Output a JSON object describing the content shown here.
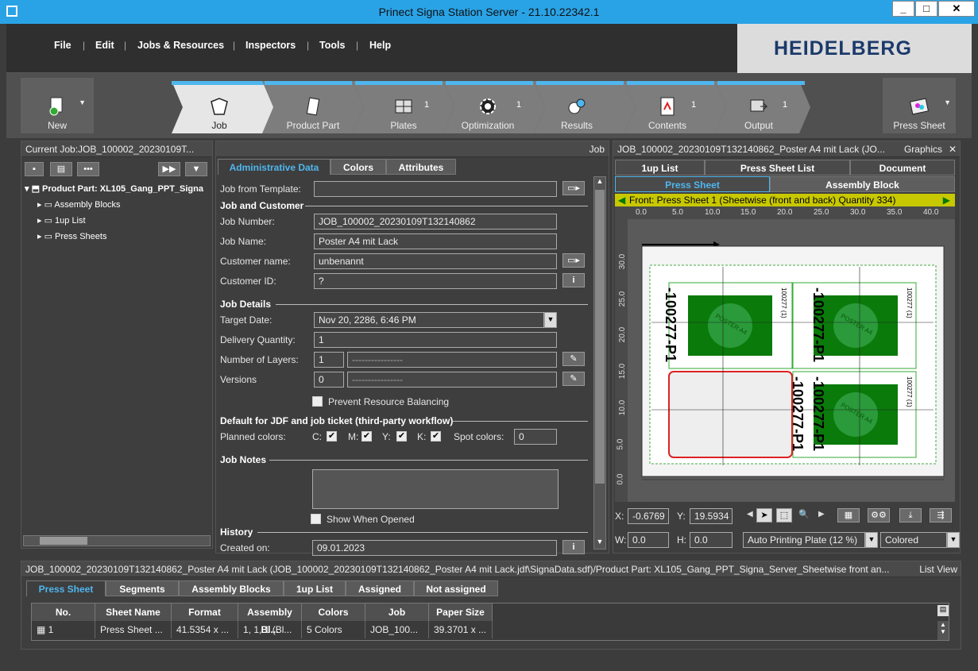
{
  "window": {
    "title": "Prinect Signa Station Server  -  21.10.22342.1",
    "min": "_",
    "max": "□",
    "close": "✕"
  },
  "menu": [
    "File",
    "Edit",
    "Jobs & Resources",
    "Inspectors",
    "Tools",
    "Help"
  ],
  "brand": "HEIDELBERG",
  "toolbar": {
    "new": "New",
    "press_sheet": "Press Sheet",
    "steps": [
      {
        "label": "Job",
        "count": ""
      },
      {
        "label": "Product Part",
        "count": ""
      },
      {
        "label": "Plates",
        "count": "1"
      },
      {
        "label": "Optimization",
        "count": "1"
      },
      {
        "label": "Results",
        "count": ""
      },
      {
        "label": "Contents",
        "count": "1"
      },
      {
        "label": "Output",
        "count": "1"
      }
    ]
  },
  "left": {
    "header": "Current Job:JOB_100002_20230109T...",
    "tree": {
      "root": "Product Part: XL105_Gang_PPT_Signa",
      "children": [
        "Assembly Blocks",
        "1up List",
        "Press Sheets"
      ]
    }
  },
  "center": {
    "header": "Job",
    "tabs": [
      "Administrative Data",
      "Colors",
      "Attributes"
    ],
    "job_from_template": "Job from Template:",
    "sec_job_customer": "Job and Customer",
    "job_number_l": "Job Number:",
    "job_number": "JOB_100002_20230109T132140862",
    "job_name_l": "Job Name:",
    "job_name": "Poster A4 mit Lack",
    "customer_name_l": "Customer name:",
    "customer_name": "unbenannt",
    "customer_id_l": "Customer ID:",
    "customer_id": "?",
    "sec_job_details": "Job Details",
    "target_date_l": "Target Date:",
    "target_date": "Nov 20, 2286, 6:46 PM",
    "delivery_qty_l": "Delivery Quantity:",
    "delivery_qty": "1",
    "layers_l": "Number of Layers:",
    "layers": "1",
    "layers_sel": "----------------",
    "versions_l": "Versions",
    "versions": "0",
    "versions_sel": "----------------",
    "prevent_balancing": "Prevent Resource Balancing",
    "sec_jdf": "Default for JDF and job ticket (third-party workflow)",
    "planned_colors_l": "Planned colors:",
    "c": "C:",
    "m": "M:",
    "y": "Y:",
    "k": "K:",
    "spot_l": "Spot colors:",
    "spot": "0",
    "sec_notes": "Job Notes",
    "show_when_opened": "Show When Opened",
    "sec_history": "History",
    "created_on_l": "Created on:",
    "created_on": "09.01.2023"
  },
  "right": {
    "header": "JOB_100002_20230109T132140862_Poster A4 mit Lack (JO...",
    "header_right": "Graphics",
    "tabs1": [
      "1up List",
      "Press Sheet List",
      "Document"
    ],
    "tabs2": [
      "Press Sheet",
      "Assembly Block"
    ],
    "sheet_label": "Front:  Press Sheet 1 (Sheetwise (front and back) Quantity 334)",
    "ruler_x": [
      "0.0",
      "5.0",
      "10.0",
      "15.0",
      "20.0",
      "25.0",
      "30.0",
      "35.0",
      "40.0"
    ],
    "ruler_y": [
      "30.0",
      "25.0",
      "20.0",
      "15.0",
      "10.0",
      "5.0",
      "0.0"
    ],
    "x_label": "X:",
    "x_val": "-0.6769",
    "y_label": "Y:",
    "y_val": "19.5934",
    "w_label": "W:",
    "w_val": "0.0",
    "h_label": "H:",
    "h_val": "0.0",
    "plate_select": "Auto Printing Plate (12 %)",
    "color_select": "Colored",
    "part_label": "-100277-P1",
    "part_small": "100277 (1)",
    "poster_text": "POSTER A4"
  },
  "bottom": {
    "path": "JOB_100002_20230109T132140862_Poster A4 mit Lack (JOB_100002_20230109T132140862_Poster A4 mit Lack.jdf\\SignaData.sdf)/Product Part: XL105_Gang_PPT_Signa_Server_Sheetwise front an...",
    "view": "List View",
    "tabs": [
      "Press Sheet",
      "Segments",
      "Assembly Blocks",
      "1up List",
      "Assigned",
      "Not assigned"
    ],
    "columns": [
      "No.",
      "Sheet Name",
      "Format",
      "Assembly Bl...",
      "Colors",
      "Job",
      "Paper Size"
    ],
    "rows": [
      [
        "1",
        "Press Sheet ...",
        "41.5354 x ...",
        "1, 1, 1 (Bl...",
        "5 Colors",
        "JOB_100...",
        "39.3701 x ..."
      ]
    ]
  }
}
